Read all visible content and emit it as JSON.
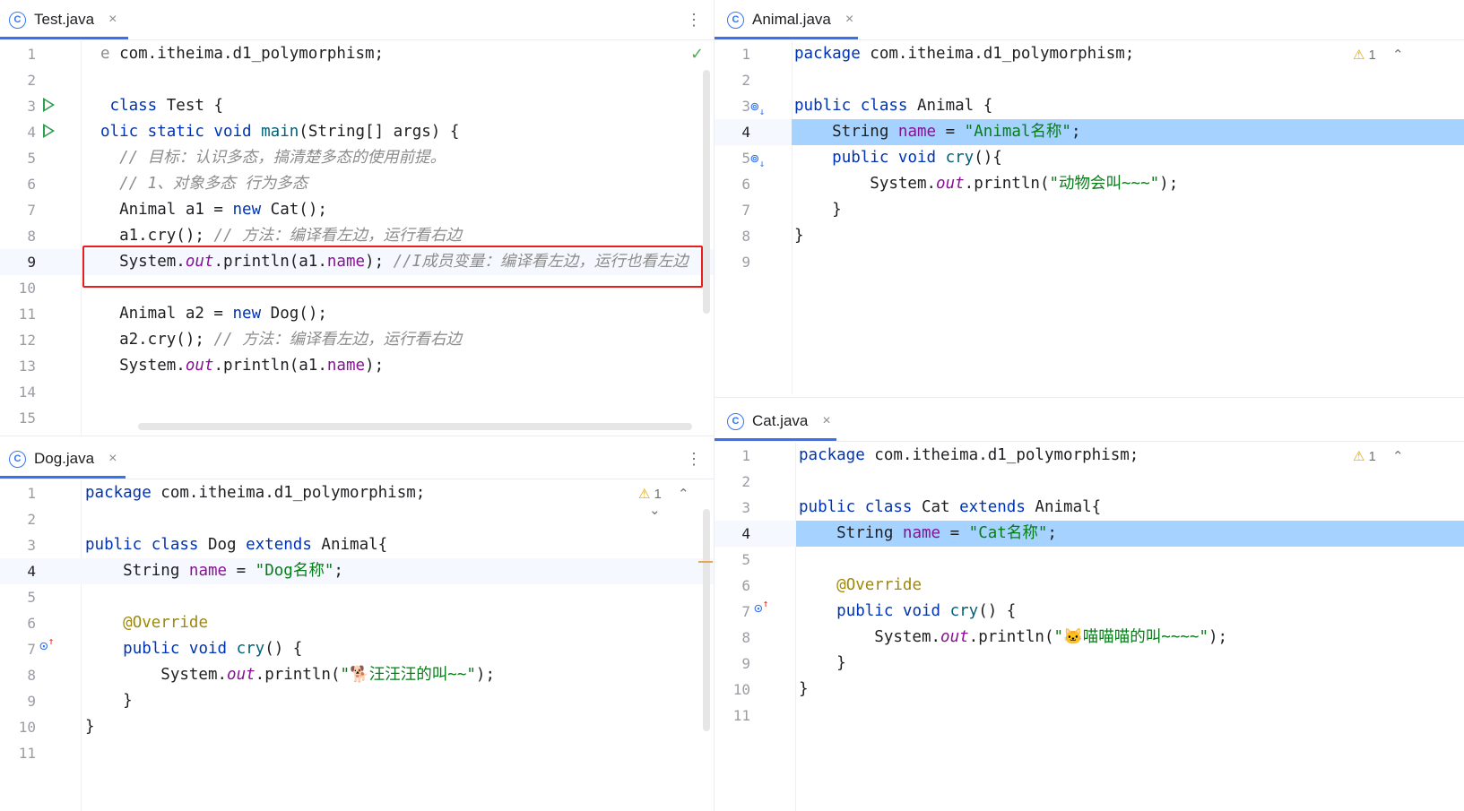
{
  "panes": {
    "test": {
      "tab": "Test.java",
      "lines": [
        {
          "n": "1",
          "segs": [
            [
              "gray",
              "e "
            ],
            [
              "",
              "com.itheima.d1_polymorphism;"
            ]
          ]
        },
        {
          "n": "2",
          "segs": []
        },
        {
          "n": "3",
          "segs": [
            [
              "kw",
              " class "
            ],
            [
              "",
              "Test {"
            ]
          ]
        },
        {
          "n": "4",
          "segs": [
            [
              "kw",
              "olic static void "
            ],
            [
              "mth",
              "main"
            ],
            [
              "",
              "(String[] args) {"
            ]
          ]
        },
        {
          "n": "5",
          "segs": [
            [
              "",
              "  "
            ],
            [
              "cm",
              "// 目标：认识多态，搞清楚多态的使用前提。"
            ]
          ]
        },
        {
          "n": "6",
          "segs": [
            [
              "",
              "  "
            ],
            [
              "cm",
              "// 1、对象多态 行为多态"
            ]
          ]
        },
        {
          "n": "7",
          "segs": [
            [
              "",
              "  Animal a1 = "
            ],
            [
              "kw",
              "new "
            ],
            [
              "",
              "Cat();"
            ]
          ]
        },
        {
          "n": "8",
          "segs": [
            [
              "",
              "  a1.cry(); "
            ],
            [
              "cm",
              "// 方法：编译看左边，运行看右边"
            ]
          ]
        },
        {
          "n": "9",
          "segs": [
            [
              "",
              "  System."
            ],
            [
              "fld it",
              "out"
            ],
            [
              "",
              ".println(a1."
            ],
            [
              "fld",
              "name"
            ],
            [
              "",
              "); "
            ],
            [
              "cm",
              "//I成员变量：编译看左边，运行也看左边"
            ]
          ]
        },
        {
          "n": "10",
          "segs": []
        },
        {
          "n": "11",
          "segs": [
            [
              "",
              "  Animal a2 = "
            ],
            [
              "kw",
              "new "
            ],
            [
              "",
              "Dog();"
            ]
          ]
        },
        {
          "n": "12",
          "segs": [
            [
              "",
              "  a2.cry(); "
            ],
            [
              "cm",
              "// 方法：编译看左边，运行看右边"
            ]
          ]
        },
        {
          "n": "13",
          "segs": [
            [
              "",
              "  System."
            ],
            [
              "fld it",
              "out"
            ],
            [
              "",
              ".println(a1."
            ],
            [
              "fld",
              "name"
            ],
            [
              "",
              ");"
            ]
          ]
        },
        {
          "n": "14",
          "segs": []
        },
        {
          "n": "15",
          "segs": []
        }
      ]
    },
    "animal": {
      "tab": "Animal.java",
      "warn": "1",
      "lines": [
        {
          "n": "1",
          "segs": [
            [
              "kw",
              "package "
            ],
            [
              "",
              "com.itheima.d1_polymorphism;"
            ]
          ]
        },
        {
          "n": "2",
          "segs": []
        },
        {
          "n": "3",
          "segs": [
            [
              "kw",
              "public class "
            ],
            [
              "",
              "Animal {"
            ]
          ]
        },
        {
          "n": "4",
          "segs": [
            [
              "",
              "    String "
            ],
            [
              "fld",
              "name"
            ],
            [
              "",
              " = "
            ],
            [
              "str",
              "\"Animal名称\""
            ],
            [
              "",
              ";"
            ]
          ]
        },
        {
          "n": "5",
          "segs": [
            [
              "",
              "    "
            ],
            [
              "kw",
              "public void "
            ],
            [
              "mth",
              "cry"
            ],
            [
              "",
              "(){"
            ]
          ]
        },
        {
          "n": "6",
          "segs": [
            [
              "",
              "        System."
            ],
            [
              "fld it",
              "out"
            ],
            [
              "",
              ".println("
            ],
            [
              "str",
              "\"动物会叫~~~\""
            ],
            [
              "",
              ");"
            ]
          ]
        },
        {
          "n": "7",
          "segs": [
            [
              "",
              "    }"
            ]
          ]
        },
        {
          "n": "8",
          "segs": [
            [
              "",
              "}"
            ]
          ]
        },
        {
          "n": "9",
          "segs": []
        }
      ]
    },
    "dog": {
      "tab": "Dog.java",
      "warn": "1",
      "lines": [
        {
          "n": "1",
          "segs": [
            [
              "kw",
              "package "
            ],
            [
              "",
              "com.itheima.d1_polymorphism;"
            ]
          ]
        },
        {
          "n": "2",
          "segs": []
        },
        {
          "n": "3",
          "segs": [
            [
              "kw",
              "public class "
            ],
            [
              "",
              "Dog "
            ],
            [
              "kw",
              "extends "
            ],
            [
              "",
              "Animal{"
            ]
          ]
        },
        {
          "n": "4",
          "segs": [
            [
              "",
              "    String "
            ],
            [
              "fld",
              "name"
            ],
            [
              "",
              " = "
            ],
            [
              "str",
              "\"Dog名称\""
            ],
            [
              "",
              ";"
            ]
          ]
        },
        {
          "n": "5",
          "segs": []
        },
        {
          "n": "6",
          "segs": [
            [
              "",
              "    "
            ],
            [
              "ann",
              "@Override"
            ]
          ]
        },
        {
          "n": "7",
          "segs": [
            [
              "",
              "    "
            ],
            [
              "kw",
              "public void "
            ],
            [
              "mth",
              "cry"
            ],
            [
              "",
              "() {"
            ]
          ]
        },
        {
          "n": "8",
          "segs": [
            [
              "",
              "        System."
            ],
            [
              "fld it",
              "out"
            ],
            [
              "",
              ".println("
            ],
            [
              "str",
              "\"🐕汪汪汪的叫~~\""
            ],
            [
              "",
              ");"
            ]
          ]
        },
        {
          "n": "9",
          "segs": [
            [
              "",
              "    }"
            ]
          ]
        },
        {
          "n": "10",
          "segs": [
            [
              "",
              "}"
            ]
          ]
        },
        {
          "n": "11",
          "segs": []
        }
      ]
    },
    "cat": {
      "tab": "Cat.java",
      "warn": "1",
      "lines": [
        {
          "n": "1",
          "segs": [
            [
              "kw",
              "package "
            ],
            [
              "",
              "com.itheima.d1_polymorphism;"
            ]
          ]
        },
        {
          "n": "2",
          "segs": []
        },
        {
          "n": "3",
          "segs": [
            [
              "kw",
              "public class "
            ],
            [
              "",
              "Cat "
            ],
            [
              "kw",
              "extends "
            ],
            [
              "",
              "Animal{"
            ]
          ]
        },
        {
          "n": "4",
          "segs": [
            [
              "",
              "    String "
            ],
            [
              "fld",
              "name"
            ],
            [
              "",
              " = "
            ],
            [
              "str",
              "\"Cat名称\""
            ],
            [
              "",
              ";"
            ]
          ]
        },
        {
          "n": "5",
          "segs": []
        },
        {
          "n": "6",
          "segs": [
            [
              "",
              "    "
            ],
            [
              "ann",
              "@Override"
            ]
          ]
        },
        {
          "n": "7",
          "segs": [
            [
              "",
              "    "
            ],
            [
              "kw",
              "public void "
            ],
            [
              "mth",
              "cry"
            ],
            [
              "",
              "() {"
            ]
          ]
        },
        {
          "n": "8",
          "segs": [
            [
              "",
              "        System."
            ],
            [
              "fld it",
              "out"
            ],
            [
              "",
              ".println("
            ],
            [
              "str",
              "\"🐱喵喵喵的叫~~~~\""
            ],
            [
              "",
              ");"
            ]
          ]
        },
        {
          "n": "9",
          "segs": [
            [
              "",
              "    }"
            ]
          ]
        },
        {
          "n": "10",
          "segs": [
            [
              "",
              "}"
            ]
          ]
        },
        {
          "n": "11",
          "segs": []
        }
      ]
    }
  },
  "icons": {
    "file_icon": "C",
    "close": "×",
    "kebab": "⋮",
    "warn_triangle": "⚠",
    "check": "✓",
    "chevron_up": "⌃",
    "chevron_down": "⌄"
  }
}
